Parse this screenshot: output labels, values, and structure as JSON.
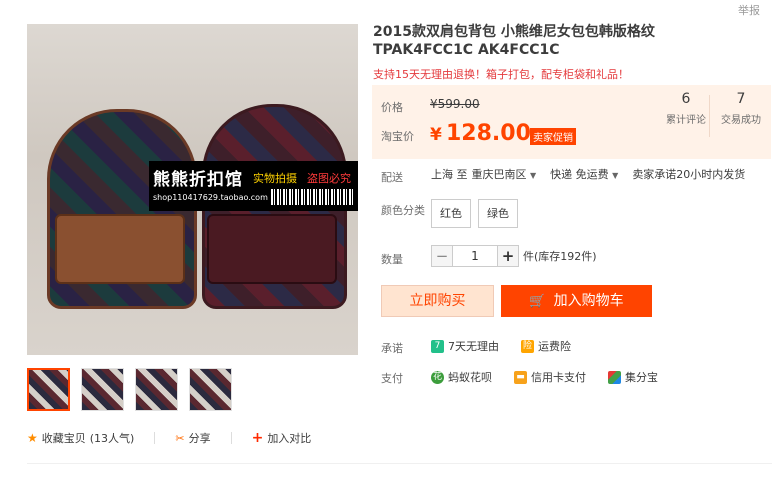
{
  "report_link": "举报",
  "product": {
    "title": "2015款双肩包背包 小熊维尼女包包韩版格纹TPAK4FCC1C AK4FCC1C",
    "subtitle": "支持15天无理由退换！箱子打包，配专柜袋和礼品！"
  },
  "gallery": {
    "watermark_title": "熊熊折扣馆",
    "watermark_tag1": "实物拍摄",
    "watermark_tag2": "盗图必究",
    "watermark_url": "shop110417629.taobao.com",
    "thumbnail_count": 4
  },
  "price": {
    "label": "价格",
    "original": "¥599.00",
    "promo_label": "淘宝价",
    "currency": "¥",
    "current": "128.00",
    "promo_badge": "卖家促销"
  },
  "stats": {
    "reviews_count": "6",
    "reviews_label": "累计评论",
    "sales_count": "7",
    "sales_label": "交易成功"
  },
  "shipping": {
    "label": "配送",
    "from": "上海 至",
    "to": "重庆巴南区",
    "method": "快递 免运费",
    "promise": "卖家承诺20小时内发货"
  },
  "color": {
    "label": "颜色分类",
    "options": [
      "红色",
      "绿色"
    ]
  },
  "quantity": {
    "label": "数量",
    "minus": "−",
    "value": "1",
    "plus": "+",
    "stock": "件(库存192件)"
  },
  "actions": {
    "buy_now": "立即购买",
    "add_to_cart": "加入购物车"
  },
  "guarantee": {
    "label": "承诺",
    "items": [
      "7天无理由",
      "运费险"
    ]
  },
  "payment": {
    "label": "支付",
    "items": [
      "蚂蚁花呗",
      "信用卡支付",
      "集分宝"
    ]
  },
  "share_bar": {
    "favorite": "收藏宝贝",
    "favorite_count": "(13人气)",
    "share": "分享",
    "compare": "加入对比"
  },
  "colors": {
    "accent": "#ff4400",
    "price": "#ff4400",
    "price_bg": "#fff2e8"
  }
}
